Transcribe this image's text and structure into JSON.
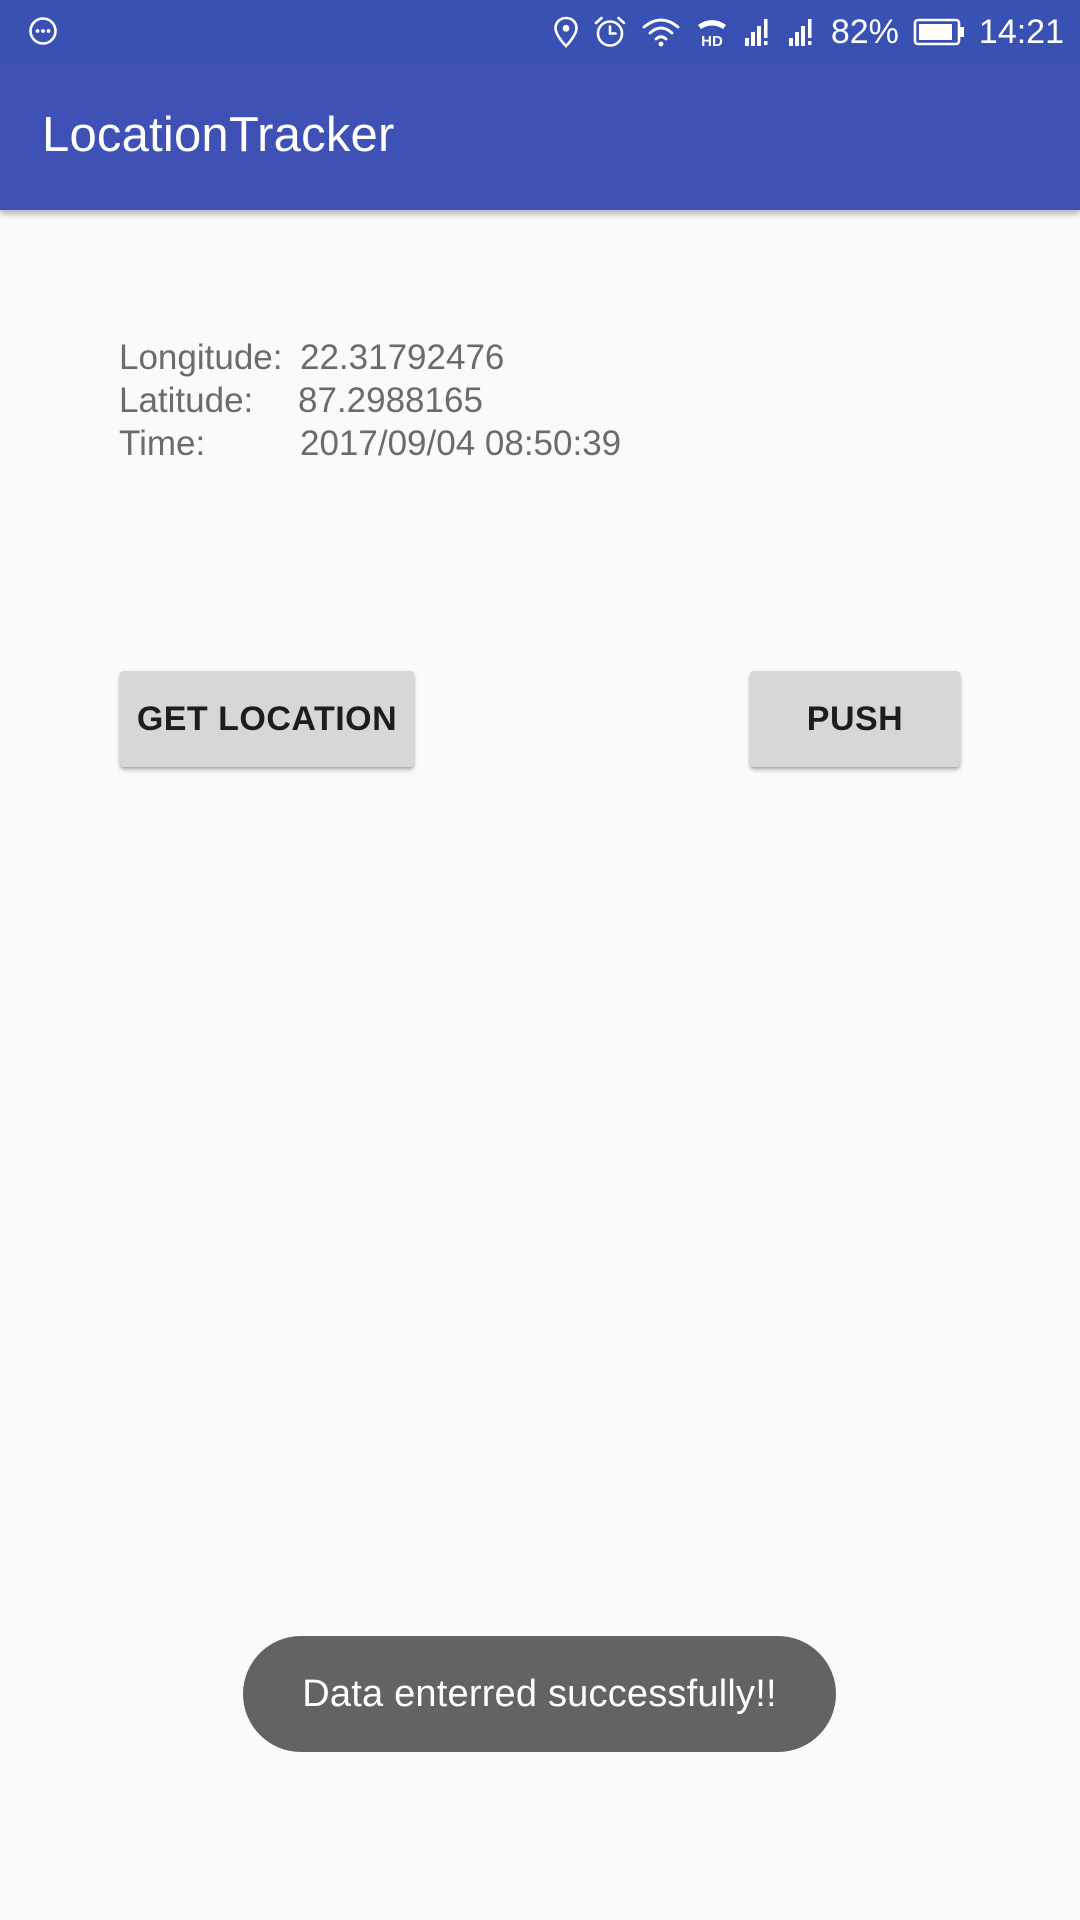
{
  "status_bar": {
    "left_icon": "more-circle-icon",
    "icons": [
      "location-pin-icon",
      "alarm-clock-icon",
      "wifi-icon",
      "hd-call-icon",
      "signal-1-icon",
      "signal-2-icon",
      "battery-icon"
    ],
    "hd_label": "HD",
    "battery_percent": "82%",
    "time": "14:21",
    "background_color": "#3851b3"
  },
  "app_bar": {
    "title": "LocationTracker",
    "background_color": "#3f51b5"
  },
  "location_info": {
    "longitude_label": "Longitude:",
    "longitude_value": "22.31792476",
    "latitude_label": "Latitude:",
    "latitude_value": "87.2988165",
    "time_label": "Time:",
    "time_value": "2017/09/04 08:50:39"
  },
  "buttons": {
    "get_location": "GET LOCATION",
    "push": "PUSH"
  },
  "toast": {
    "message": "Data enterred successfully!!"
  }
}
